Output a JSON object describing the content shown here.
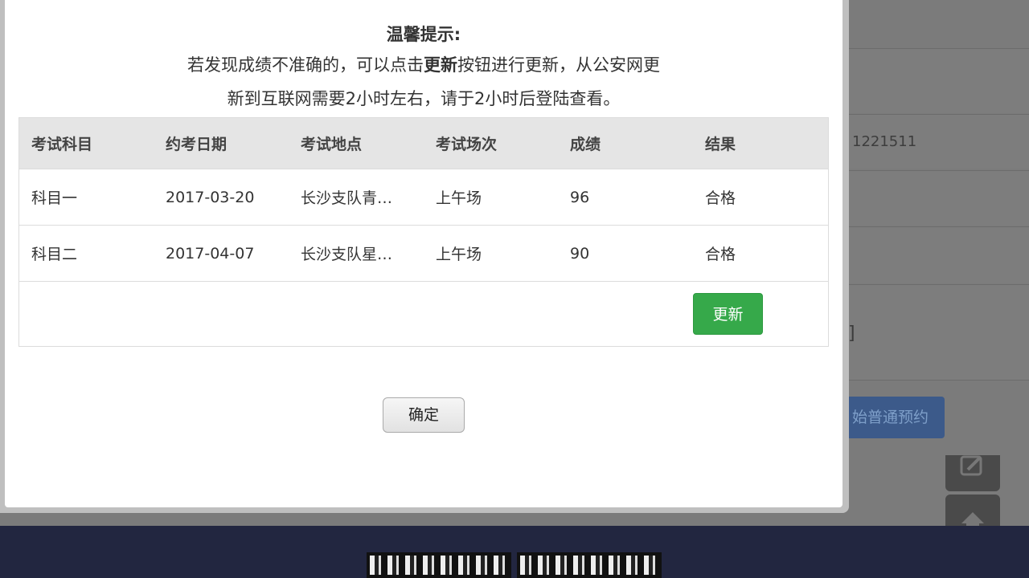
{
  "background": {
    "partial_id": "1221511",
    "bracket": "]",
    "reserve_button_label": "始普通预约",
    "edit_icon": "edit-icon",
    "top_icon": "arrow-up-icon"
  },
  "modal": {
    "tip_title": "温馨提示:",
    "tip_line1_pre": "若发现成绩不准确的，可以点击",
    "tip_line1_bold": "更新",
    "tip_line1_post": "按钮进行更新，从公安网更",
    "tip_line2": "新到互联网需要2小时左右，请于2小时后登陆查看。",
    "table": {
      "headers": [
        "考试科目",
        "约考日期",
        "考试地点",
        "考试场次",
        "成绩",
        "结果"
      ],
      "rows": [
        [
          "科目一",
          "2017-03-20",
          "长沙支队青…",
          "上午场",
          "96",
          "合格"
        ],
        [
          "科目二",
          "2017-04-07",
          "长沙支队星…",
          "上午场",
          "90",
          "合格"
        ]
      ]
    },
    "update_button_label": "更新",
    "confirm_button_label": "确定"
  }
}
